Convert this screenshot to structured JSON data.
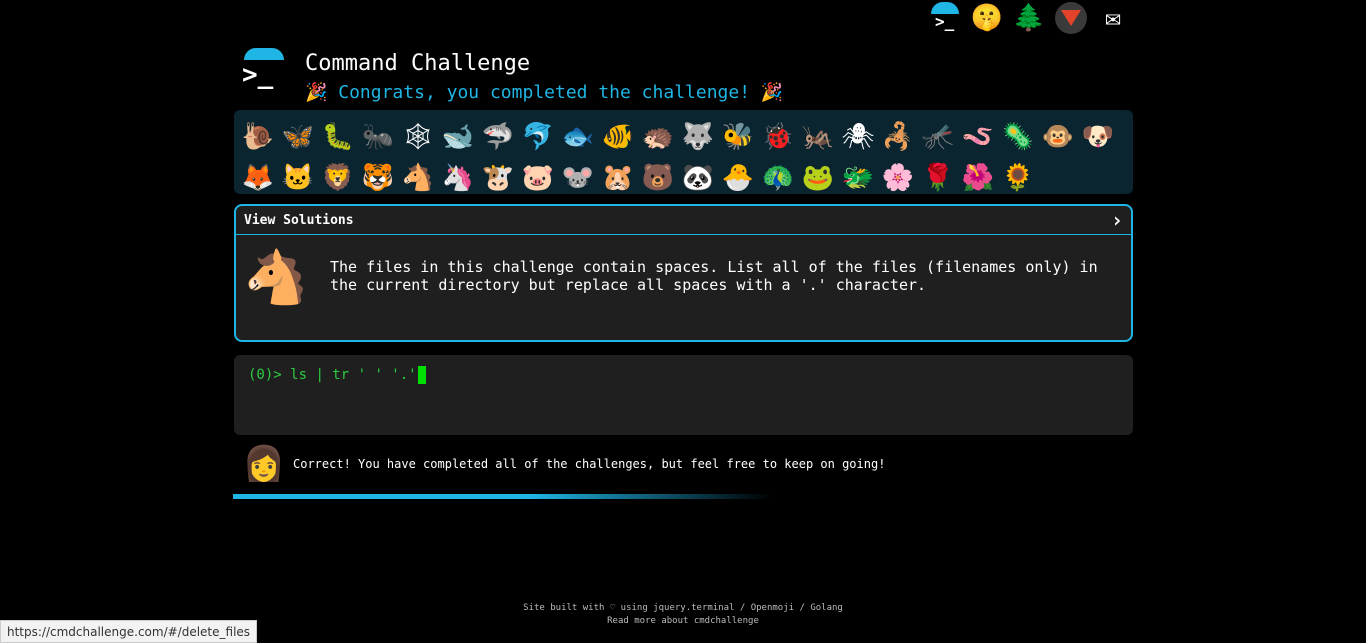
{
  "header": {
    "title": "Command Challenge",
    "congrats": "🎉 Congrats, you completed the challenge! 🎉"
  },
  "topnav": {
    "icons": [
      "terminal-icon",
      "shush-face-icon",
      "tree-icon",
      "gitlab-icon",
      "envelope-icon"
    ]
  },
  "badges": [
    "🐌",
    "🦋",
    "🐛",
    "🐜",
    "🕸",
    "🐋",
    "🦈",
    "🐬",
    "🐟",
    "🐠",
    "🦔",
    "🐺",
    "🐝",
    "🐞",
    "🦗",
    "🕷",
    "🦂",
    "🦟",
    "🪱",
    "🦠",
    "🐵",
    "🐶",
    "🦊",
    "🐱",
    "🦁",
    "🐯",
    "🐴",
    "🦄",
    "🐮",
    "🐷",
    "🐭",
    "🐹",
    "🐻",
    "🐼",
    "🐣",
    "🦚",
    "🐸",
    "🐲",
    "🌸",
    "🌹",
    "🌺",
    "🌻"
  ],
  "challenge": {
    "solutions_label": "View Solutions",
    "chevron": "›",
    "animal": "🐴",
    "description": "The files in this challenge contain spaces. List all of the files (filenames only) in the current directory but replace all spaces with a '.' character."
  },
  "terminal": {
    "prompt": "(0)> ",
    "command": "ls | tr ' ' '.'"
  },
  "feedback": {
    "avatar": "👩",
    "message": "Correct! You have completed all of the challenges, but feel free to keep on going!"
  },
  "footer": {
    "line1": "Site built with ♡ using jquery.terminal / Openmoji / Golang",
    "line2": "Read more about cmdchallenge"
  },
  "statusbar": {
    "url": "https://cmdchallenge.com/#/delete_files"
  },
  "colors": {
    "accent": "#1fb6e6",
    "terminal_text": "#2ecc40",
    "panel_bg": "#1f1f1f",
    "badges_bg": "#0a2430"
  }
}
